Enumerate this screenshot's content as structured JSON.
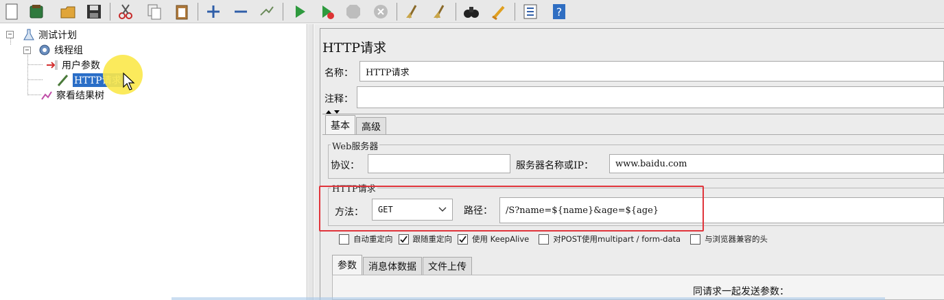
{
  "toolbar": {
    "icons": [
      "new-icon",
      "templates-icon",
      "open-icon",
      "save-icon",
      "cut-icon",
      "copy-icon",
      "paste-icon",
      "expand-icon",
      "collapse-icon",
      "toggle-icon",
      "start-icon",
      "start-no-pause-icon",
      "stop-icon",
      "shutdown-icon",
      "clear-icon",
      "clear-all-icon",
      "search-icon",
      "reset-search-icon",
      "function-helper-icon",
      "help-icon"
    ]
  },
  "tree": {
    "root": "测试计划",
    "thread_group": "线程组",
    "user_params": "用户参数",
    "http_request": "HTTP请求",
    "result_tree": "察看结果树"
  },
  "panel": {
    "title": "HTTP请求",
    "name_label": "名称：",
    "name_value": "HTTP请求",
    "comment_label": "注释：",
    "tabs": {
      "basic": "基本",
      "advanced": "高级"
    },
    "web_server": {
      "title": "Web服务器",
      "protocol_label": "协议：",
      "protocol_value": "",
      "server_label": "服务器名称或IP：",
      "server_value": "www.baidu.com"
    },
    "http_request": {
      "title": "HTTP请求",
      "method_label": "方法：",
      "method_value": "GET",
      "path_label": "路径：",
      "path_value": "/S?name=${name}&age=${age}"
    },
    "options": [
      {
        "label": "自动重定向",
        "checked": false
      },
      {
        "label": "跟随重定向",
        "checked": true
      },
      {
        "label": "使用 KeepAlive",
        "checked": true
      },
      {
        "label": "对POST使用multipart / form-data",
        "checked": false
      },
      {
        "label": "与浏览器兼容的头",
        "checked": false
      }
    ],
    "sub_tabs": {
      "params": "参数",
      "body": "消息体数据",
      "files": "文件上传"
    },
    "params_heading": "同请求一起发送参数："
  },
  "colors": {
    "highlight": "#e0333a",
    "selection": "#2a6ec7"
  }
}
